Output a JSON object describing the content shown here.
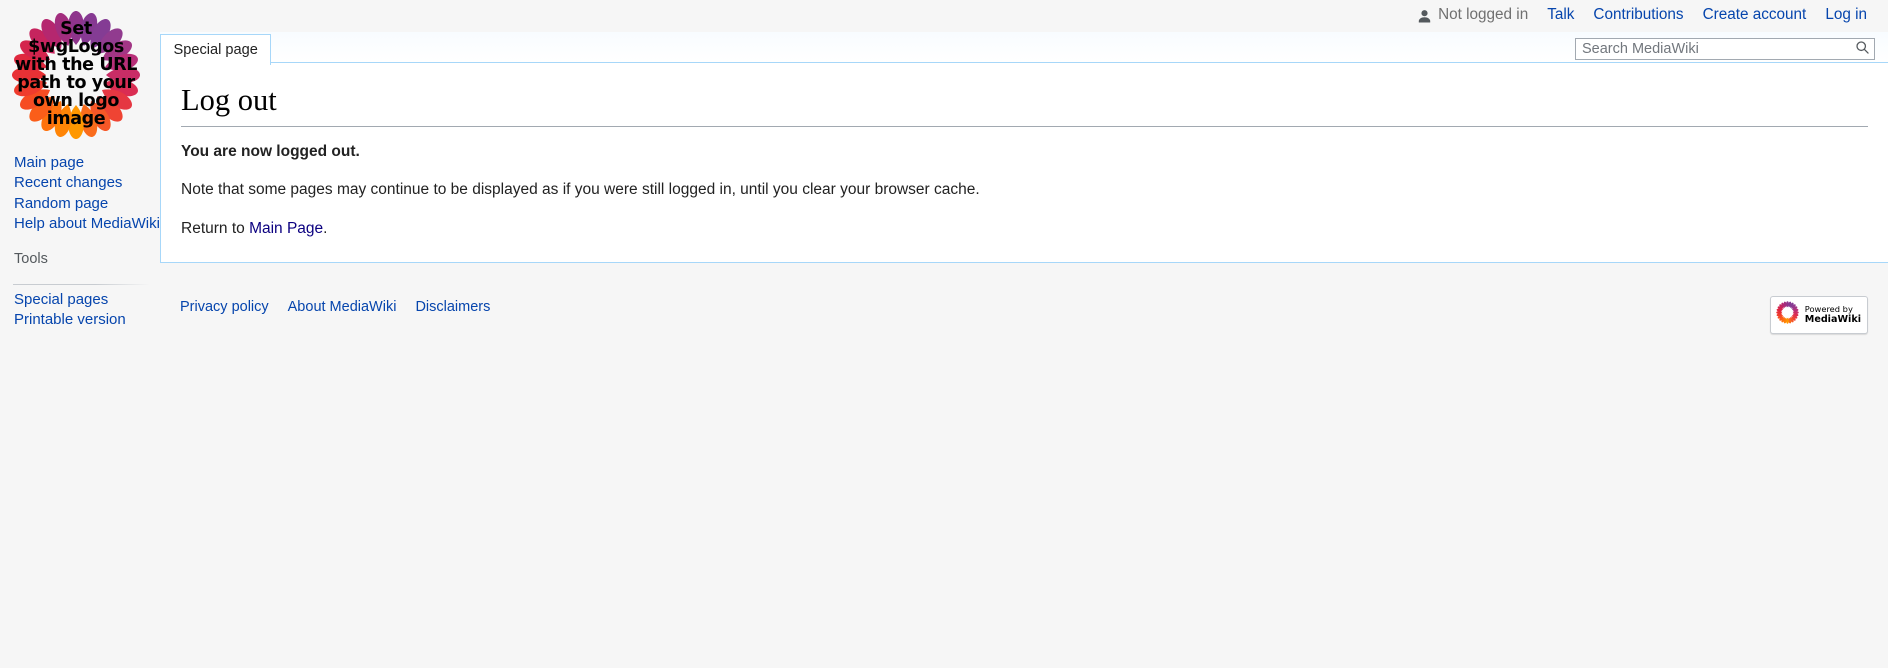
{
  "site": {
    "name": "MediaWiki",
    "logo_alt": "MediaWiki default placeholder logo",
    "logo_lines": [
      "Set",
      "$wgLogos",
      "with the URL",
      "path to your",
      "own logo",
      "image"
    ]
  },
  "personal_bar": {
    "user_icon": "user-icon",
    "status": "Not logged in",
    "links": [
      {
        "label": "Talk",
        "name": "personal-link-talk"
      },
      {
        "label": "Contributions",
        "name": "personal-link-contributions"
      },
      {
        "label": "Create account",
        "name": "personal-link-create-account"
      },
      {
        "label": "Log in",
        "name": "personal-link-log-in"
      }
    ]
  },
  "namespaces": {
    "tabs": [
      {
        "label": "Special page",
        "selected": true,
        "name": "tab-special-page"
      }
    ]
  },
  "search": {
    "placeholder": "Search MediaWiki",
    "value": "",
    "icon": "search-icon"
  },
  "sidebar": {
    "portals": [
      {
        "heading": "",
        "name": "portal-navigation",
        "items": [
          {
            "label": "Main page",
            "name": "sidebar-item-main-page"
          },
          {
            "label": "Recent changes",
            "name": "sidebar-item-recent-changes"
          },
          {
            "label": "Random page",
            "name": "sidebar-item-random-page"
          },
          {
            "label": "Help about MediaWiki",
            "name": "sidebar-item-help-about-mediawiki"
          }
        ]
      },
      {
        "heading": "Tools",
        "name": "portal-tools",
        "items": [
          {
            "label": "Special pages",
            "name": "sidebar-item-special-pages"
          },
          {
            "label": "Printable version",
            "name": "sidebar-item-printable-version"
          }
        ]
      }
    ]
  },
  "content": {
    "heading": "Log out",
    "logged_out_notice": "You are now logged out.",
    "cache_note": "Note that some pages may continue to be displayed as if you were still logged in, until you clear your browser cache.",
    "return_prefix": "Return to ",
    "return_link": "Main Page",
    "return_suffix": "."
  },
  "footer": {
    "places": [
      {
        "label": "Privacy policy",
        "name": "footer-link-privacy-policy"
      },
      {
        "label": "About MediaWiki",
        "name": "footer-link-about-mediawiki"
      },
      {
        "label": "Disclaimers",
        "name": "footer-link-disclaimers"
      }
    ],
    "poweredby": {
      "top": "Powered by",
      "bottom": "MediaWiki"
    }
  },
  "colors": {
    "link": "#0645ad",
    "visited_link": "#0b0080",
    "content_border": "#a7d7f9",
    "page_background": "#f6f6f6",
    "heading_rule": "#a2a9b1"
  }
}
